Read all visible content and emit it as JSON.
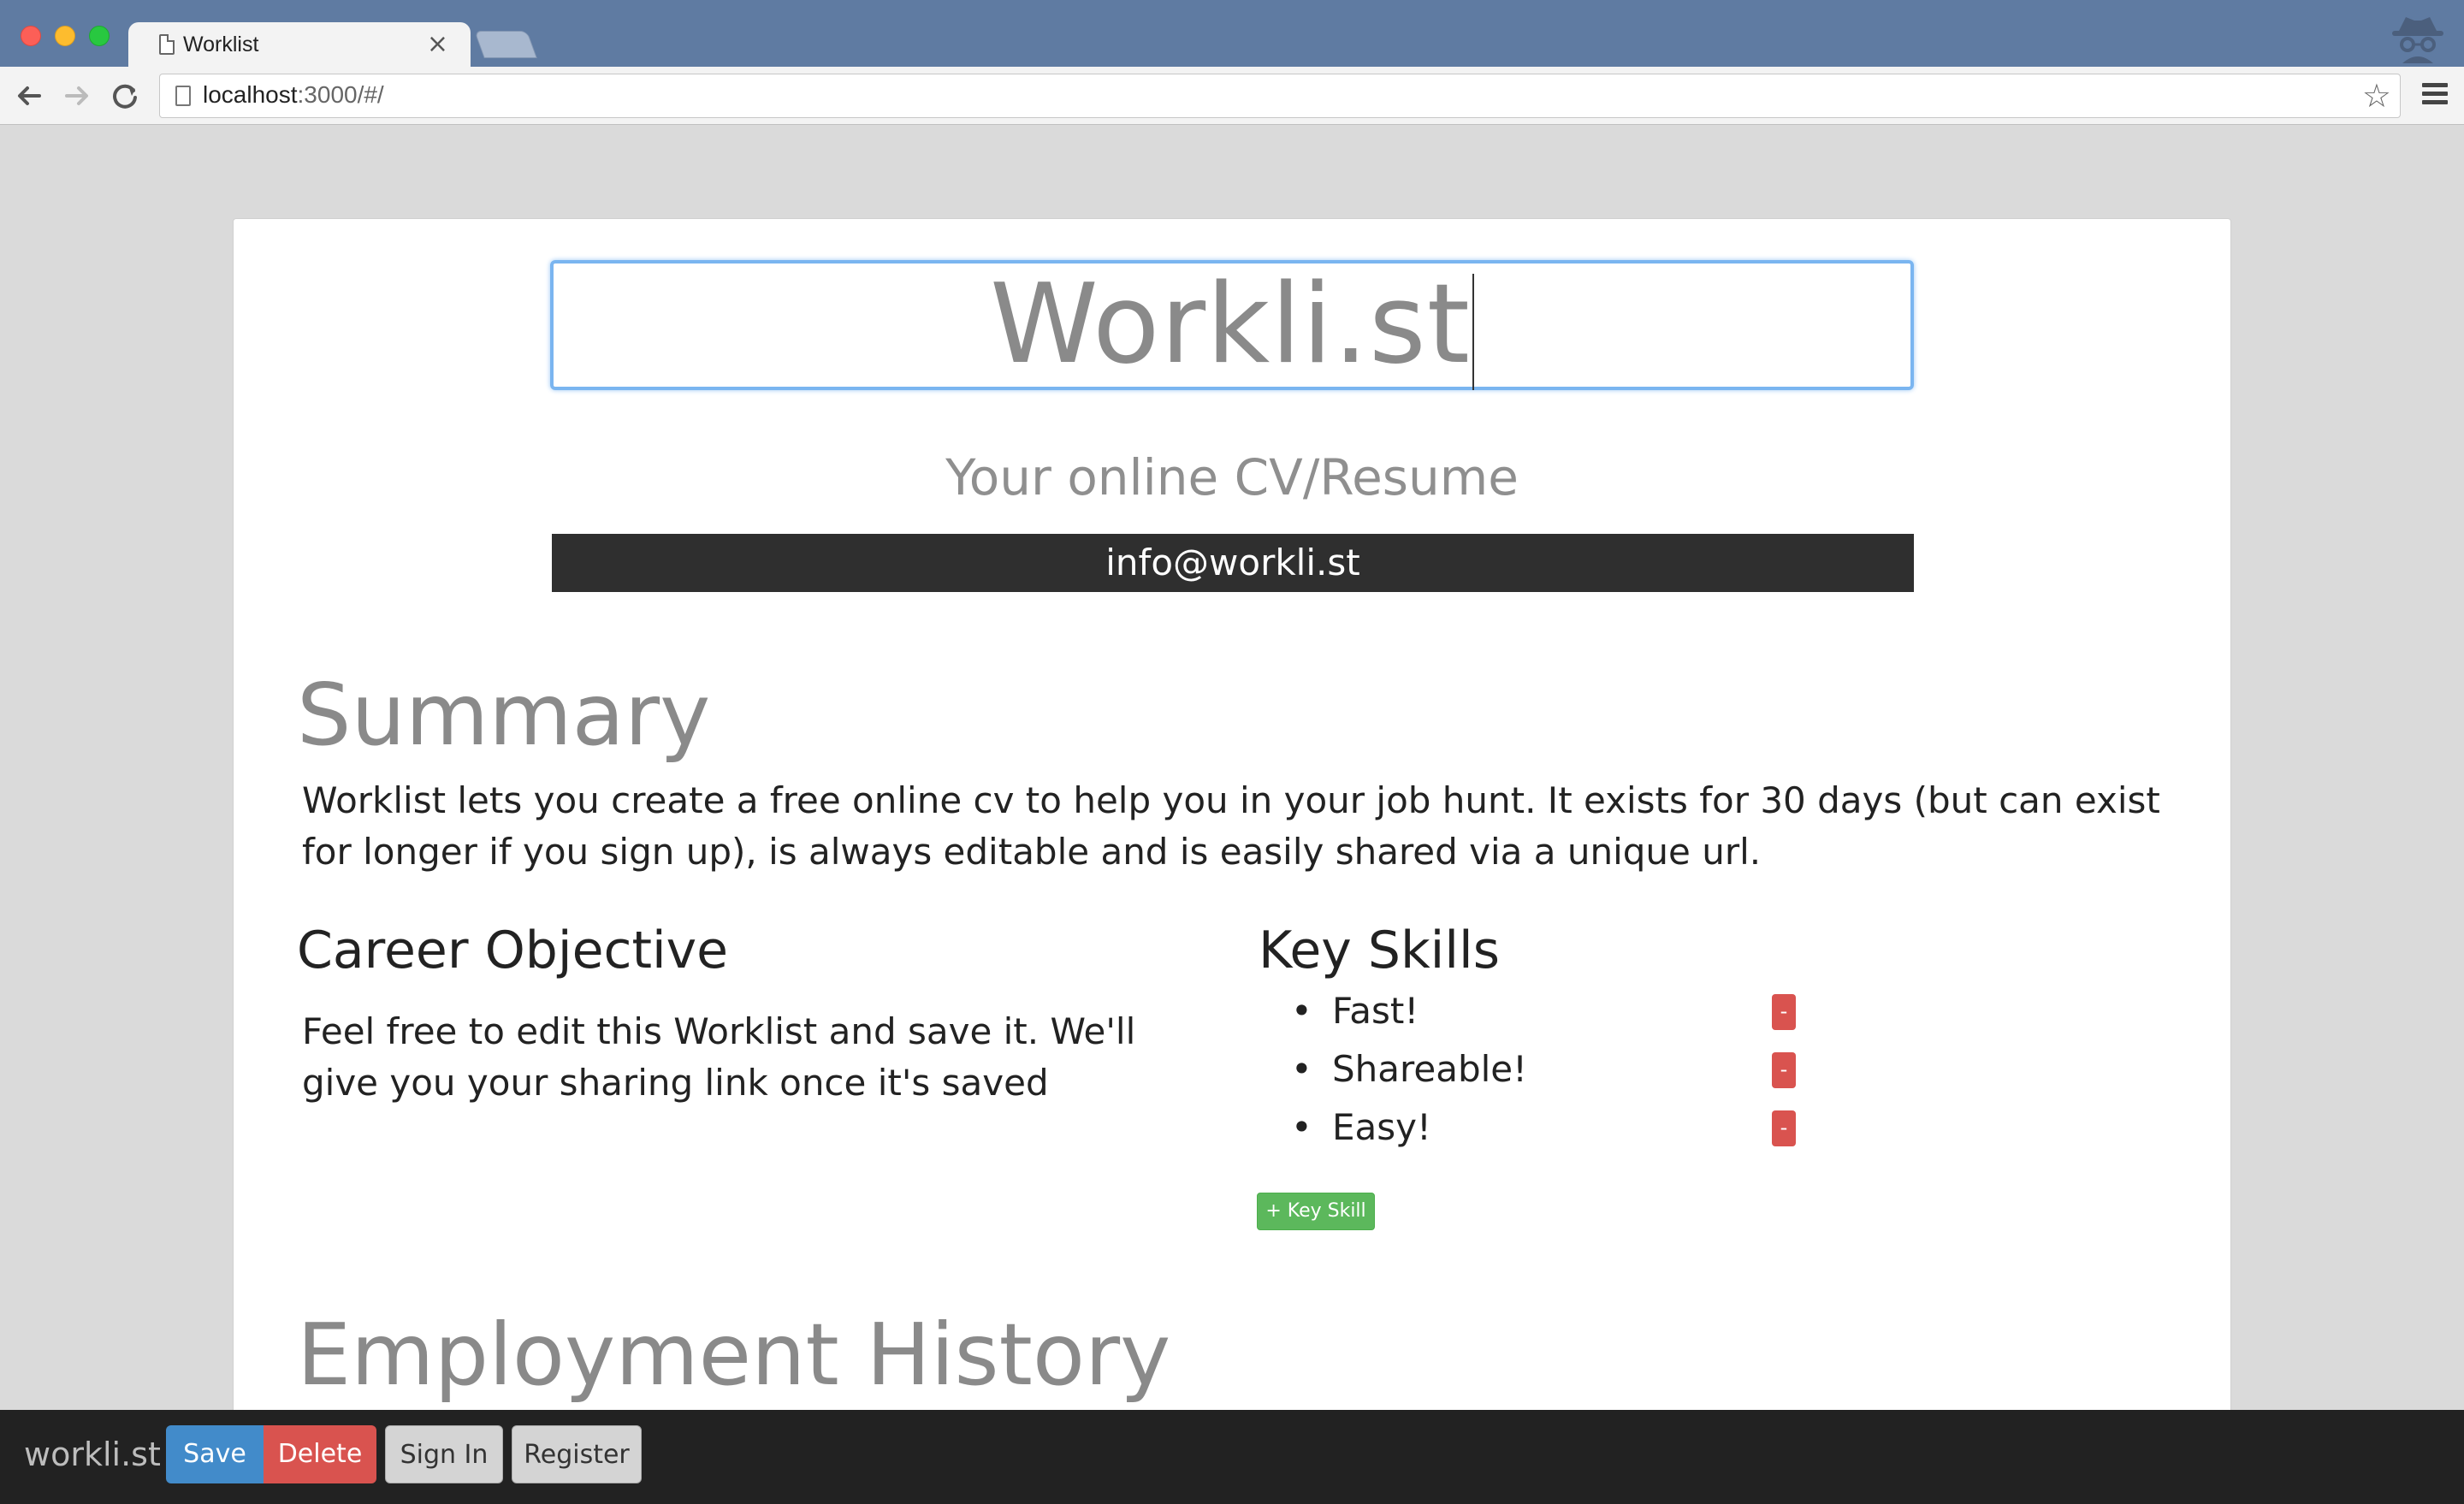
{
  "browser": {
    "tab_title": "Worklist",
    "tab_close": "×",
    "url_host": "localhost",
    "url_path": ":3000/#/",
    "back_icon": "arrow-left-icon",
    "forward_icon": "arrow-right-icon",
    "reload_icon": "reload-icon",
    "bookmark_icon": "star-icon",
    "menu_icon": "hamburger-icon"
  },
  "page": {
    "title_value": "Workli.st",
    "tagline": "Your online CV/Resume",
    "email": "info@workli.st",
    "summary_heading": "Summary",
    "summary_text": "Worklist lets you create a free online cv to help you in your job hunt. It exists for 30 days (but can exist for longer if you sign up), is always editable and is easily shared via a unique url.",
    "career_heading": "Career Objective",
    "career_text": "Feel free to edit this Worklist and save it. We'll give you your sharing link once it's saved",
    "skills_heading": "Key Skills",
    "skills": [
      {
        "label": "Fast!",
        "remove": "-"
      },
      {
        "label": "Shareable!",
        "remove": "-"
      },
      {
        "label": "Easy!",
        "remove": "-"
      }
    ],
    "add_skill_label": "+ Key Skill",
    "employment_heading": "Employment History"
  },
  "bottombar": {
    "brand": "workli.st",
    "save": "Save",
    "delete": "Delete",
    "sign_in": "Sign In",
    "register": "Register"
  },
  "colors": {
    "titlebar": "#5f7ba2",
    "save": "#428bca",
    "delete": "#d9534f",
    "add": "#5cb85c",
    "email_bar": "#2f2f2f"
  }
}
